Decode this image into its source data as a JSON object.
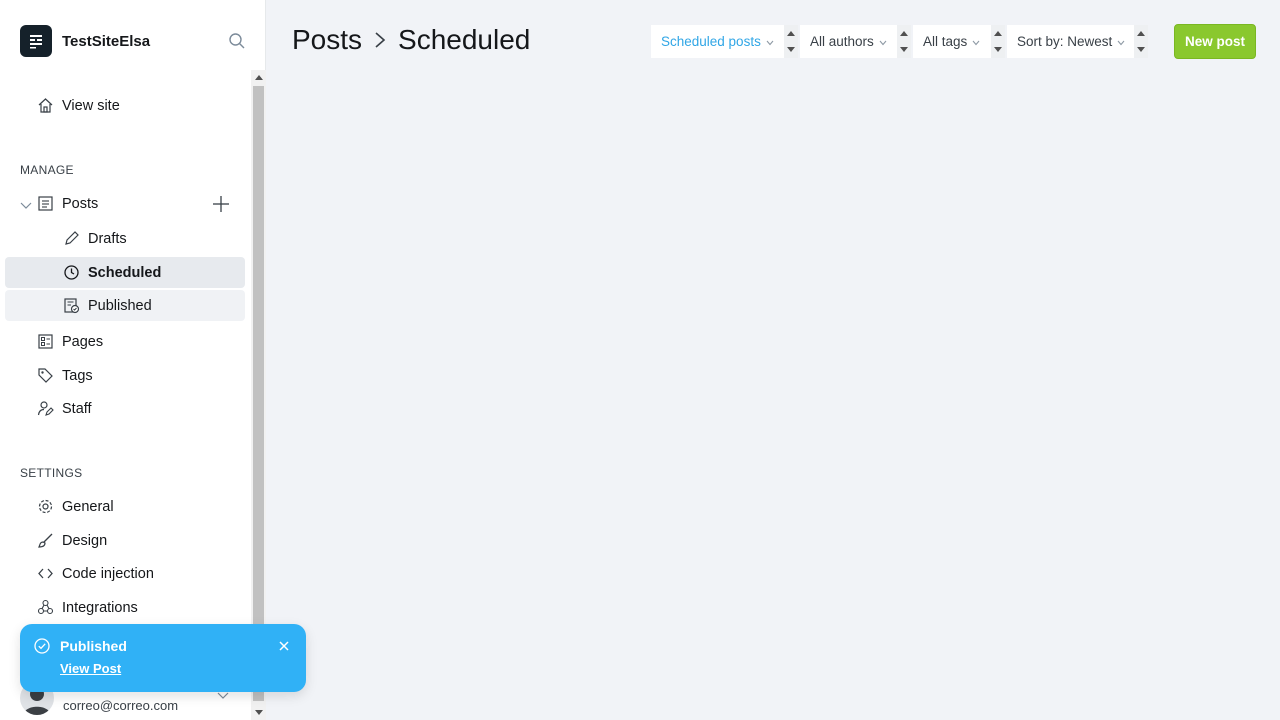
{
  "site": {
    "name": "TestSiteElsa"
  },
  "nav": {
    "view_site": "View site",
    "manage_title": "MANAGE",
    "posts": "Posts",
    "drafts": "Drafts",
    "scheduled": "Scheduled",
    "published": "Published",
    "pages": "Pages",
    "tags": "Tags",
    "staff": "Staff",
    "settings_title": "SETTINGS",
    "general": "General",
    "design": "Design",
    "code_injection": "Code injection",
    "integrations": "Integrations"
  },
  "user": {
    "email": "correo@correo.com"
  },
  "toast": {
    "title": "Published",
    "link": "View Post"
  },
  "header": {
    "crumb_parent": "Posts",
    "crumb_current": "Scheduled",
    "filters": {
      "type": "Scheduled posts",
      "authors": "All authors",
      "tags": "All tags",
      "sort": "Sort by: Newest"
    },
    "new_post": "New post"
  },
  "colors": {
    "accent_green": "#8ac82e",
    "toast_blue": "#30b1f6",
    "filter_blue": "#30a6e6"
  }
}
